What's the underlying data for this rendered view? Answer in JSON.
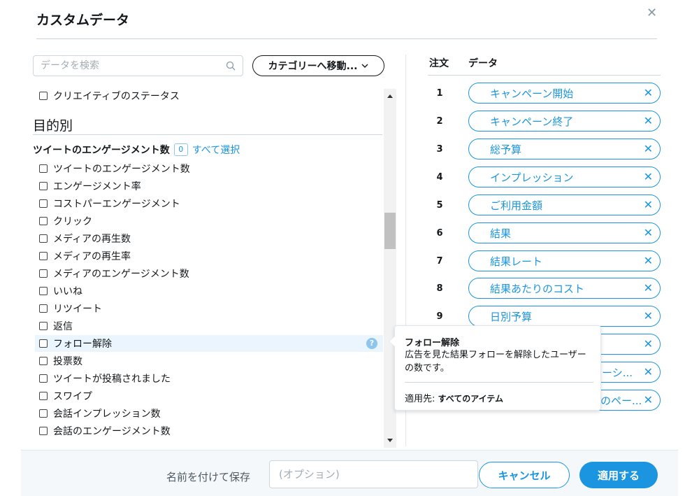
{
  "dialog": {
    "title": "カスタムデータ",
    "close_icon": "close-icon"
  },
  "search": {
    "placeholder": "データを検索",
    "icon": "search-icon"
  },
  "category_button": {
    "label": "カテゴリーへ移動...",
    "icon": "chevron-down-icon"
  },
  "left_list": {
    "top_item": "クリエイティブのステータス",
    "section_title": "目的別",
    "group_title": "ツイートのエンゲージメント数",
    "group_count": "0",
    "select_all": "すべて選択",
    "items": [
      "ツイートのエンゲージメント数",
      "エンゲージメント率",
      "コストパーエンゲージメント",
      "クリック",
      "メディアの再生数",
      "メディアの再生率",
      "メディアのエンゲージメント数",
      "いいね",
      "リツイート",
      "返信",
      "フォロー解除",
      "投票数",
      "ツイートが投稿されました",
      "スワイプ",
      "会話インプレッション数",
      "会話のエンゲージメント数"
    ]
  },
  "right_panel": {
    "order_header": "注文",
    "data_header": "データ",
    "rows": [
      {
        "order": "1",
        "label": "キャンペーン開始"
      },
      {
        "order": "2",
        "label": "キャンペーン終了"
      },
      {
        "order": "3",
        "label": "総予算"
      },
      {
        "order": "4",
        "label": "インプレッション"
      },
      {
        "order": "5",
        "label": "ご利用金額"
      },
      {
        "order": "6",
        "label": "結果"
      },
      {
        "order": "7",
        "label": "結果レート"
      },
      {
        "order": "8",
        "label": "結果あたりのコスト"
      },
      {
        "order": "9",
        "label": "日別予算"
      },
      {
        "order": "",
        "label": ""
      },
      {
        "order": "",
        "label": "ーシ..."
      },
      {
        "order": "",
        "label": "のペー..."
      }
    ]
  },
  "tooltip": {
    "title": "フォロー解除",
    "description": "広告を見た結果フォローを解除したユーザーの数です。",
    "apply_label": "適用先:",
    "apply_value": "すべてのアイテム"
  },
  "footer": {
    "save_label": "名前を付けて保存",
    "name_placeholder": "(オプション)",
    "cancel": "キャンセル",
    "apply": "適用する"
  },
  "colors": {
    "accent": "#1b95e0",
    "hover": "#eaf5fd"
  }
}
